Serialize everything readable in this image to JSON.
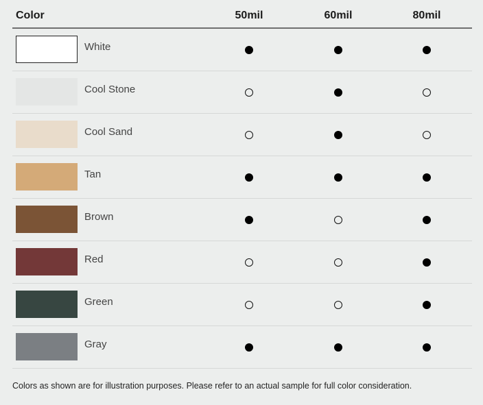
{
  "header": {
    "color_label": "Color",
    "columns": [
      "50mil",
      "60mil",
      "80mil"
    ]
  },
  "rows": [
    {
      "name": "White",
      "swatch": "#ffffff",
      "availability": [
        true,
        true,
        true
      ]
    },
    {
      "name": "Cool Stone",
      "swatch": "#e4e6e5",
      "availability": [
        false,
        true,
        false
      ]
    },
    {
      "name": "Cool Sand",
      "swatch": "#e9dccb",
      "availability": [
        false,
        true,
        false
      ]
    },
    {
      "name": "Tan",
      "swatch": "#d4aa78",
      "availability": [
        true,
        true,
        true
      ]
    },
    {
      "name": "Brown",
      "swatch": "#7b5436",
      "availability": [
        true,
        false,
        true
      ]
    },
    {
      "name": "Red",
      "swatch": "#733838",
      "availability": [
        false,
        false,
        true
      ]
    },
    {
      "name": "Green",
      "swatch": "#374641",
      "availability": [
        false,
        false,
        true
      ]
    },
    {
      "name": "Gray",
      "swatch": "#7b7f83",
      "availability": [
        true,
        true,
        true
      ]
    }
  ],
  "footnote": "Colors as shown are for illustration purposes. Please refer to an actual sample for full color consideration."
}
